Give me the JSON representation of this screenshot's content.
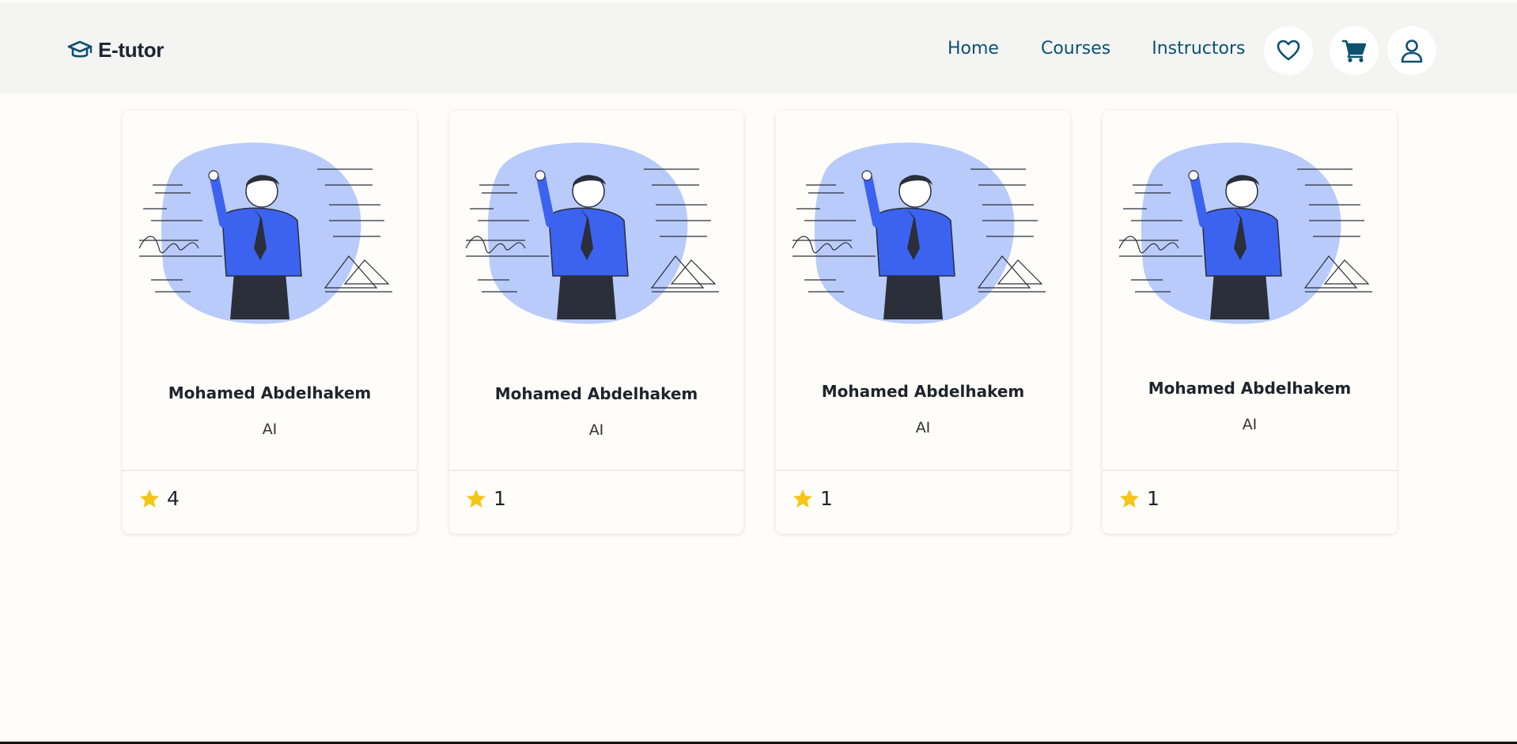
{
  "header": {
    "brand": "E-tutor",
    "nav": [
      "Home",
      "Courses",
      "Instructors"
    ],
    "icons": [
      "heart-icon",
      "cart-icon",
      "user-icon"
    ]
  },
  "colors": {
    "accent": "#0d5170",
    "star": "#f5c518",
    "blob": "#b9cbfb",
    "shirt": "#3c62f0"
  },
  "instructors": [
    {
      "name": "Mohamed Abdelhakem",
      "category": "AI",
      "rating": "4"
    },
    {
      "name": "Mohamed Abdelhakem",
      "category": "AI",
      "rating": "1"
    },
    {
      "name": "Mohamed Abdelhakem",
      "category": "AI",
      "rating": "1"
    },
    {
      "name": "Mohamed Abdelhakem",
      "category": "AI",
      "rating": "1"
    }
  ]
}
